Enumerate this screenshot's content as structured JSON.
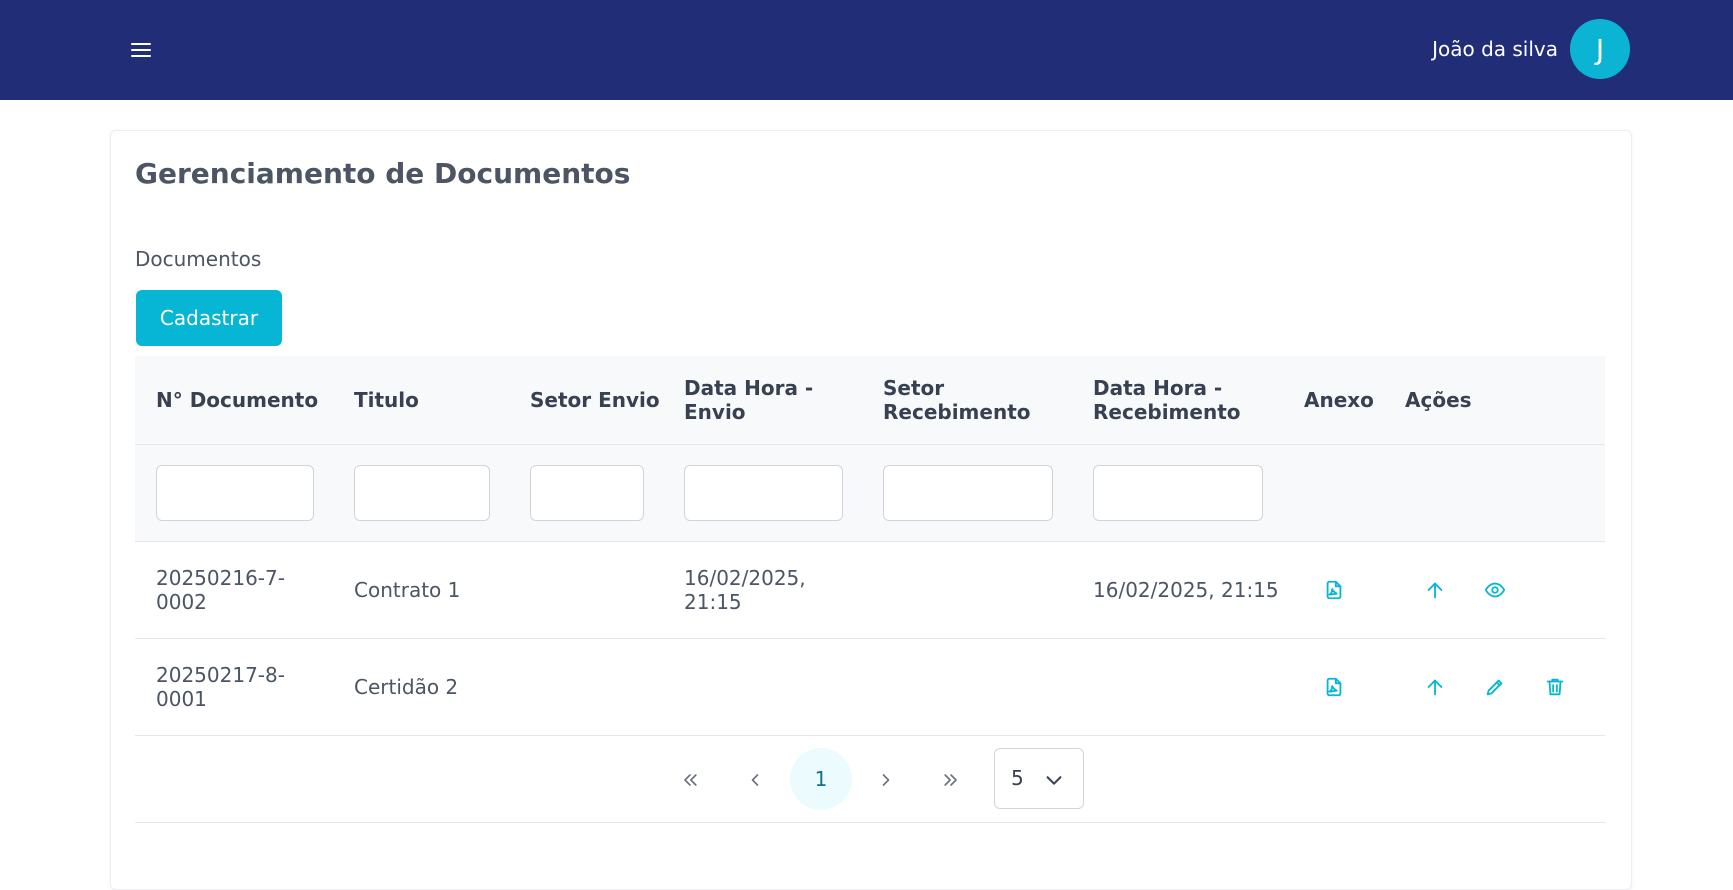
{
  "header": {
    "user_name": "João da silva",
    "avatar_initial": "J",
    "menu_icon": "hamburger-icon",
    "background_color": "#222d78",
    "avatar_color": "#0cb4d4"
  },
  "page": {
    "title": "Gerenciamento de Documentos",
    "section_label": "Documentos",
    "register_button": "Cadastrar",
    "accent_color": "#06b6d4"
  },
  "table": {
    "columns": [
      {
        "label": "N° Documento"
      },
      {
        "label": "Titulo"
      },
      {
        "label": "Setor Envio"
      },
      {
        "label": "Data Hora -\nEnvio"
      },
      {
        "label": "Setor\nRecebimento"
      },
      {
        "label": "Data Hora -\nRecebimento"
      },
      {
        "label": "Anexo"
      },
      {
        "label": "Ações"
      }
    ],
    "filters": [
      "",
      "",
      "",
      "",
      "",
      ""
    ],
    "rows": [
      {
        "numero": "20250216-7-\n0002",
        "titulo": "Contrato 1",
        "setor_envio": "",
        "data_envio": "16/02/2025,\n21:15",
        "setor_recebimento": "",
        "data_recebimento": "16/02/2025, 21:15",
        "anexo_icon": "pdf-file-icon",
        "actions": [
          "arrow-up-icon",
          "eye-icon"
        ]
      },
      {
        "numero": "20250217-8-\n0001",
        "titulo": "Certidão 2",
        "setor_envio": "",
        "data_envio": "",
        "setor_recebimento": "",
        "data_recebimento": "",
        "anexo_icon": "pdf-file-icon",
        "actions": [
          "arrow-up-icon",
          "pencil-icon",
          "trash-icon"
        ]
      }
    ]
  },
  "pagination": {
    "current_page": "1",
    "rows_per_page": "5",
    "icons": [
      "first-page-icon",
      "previous-page-icon",
      "next-page-icon",
      "last-page-icon"
    ]
  }
}
